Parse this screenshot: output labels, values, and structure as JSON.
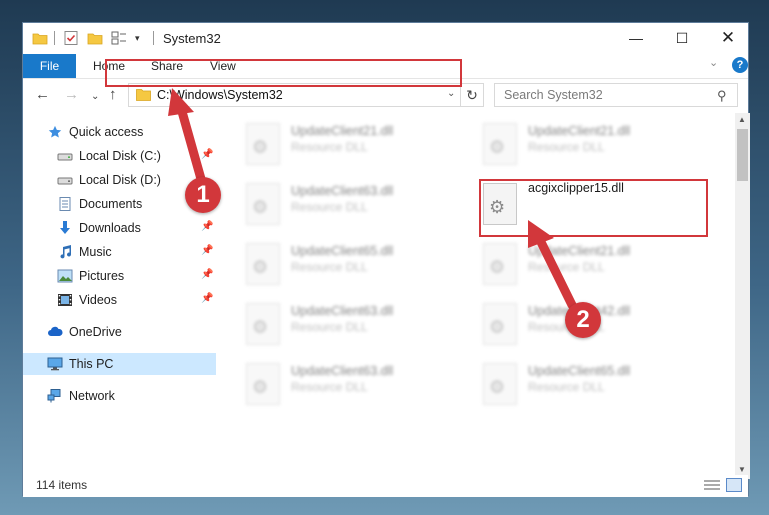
{
  "window": {
    "title": "System32",
    "controls": {
      "minimize": "—",
      "maximize": "☐",
      "close": "✕"
    }
  },
  "ribbon": {
    "tabs": [
      "File",
      "Home",
      "Share",
      "View"
    ],
    "help": "?"
  },
  "navigation": {
    "address": "C:\\Windows\\System32",
    "search_placeholder": "Search System32"
  },
  "sidebar": {
    "items": [
      {
        "label": "Quick access",
        "icon": "star-icon",
        "pinned": false
      },
      {
        "label": "Local Disk (C:)",
        "icon": "drive-icon",
        "pinned": true
      },
      {
        "label": "Local Disk (D:)",
        "icon": "drive-icon",
        "pinned": false
      },
      {
        "label": "Documents",
        "icon": "documents-icon",
        "pinned": false
      },
      {
        "label": "Downloads",
        "icon": "download-arrow-icon",
        "pinned": true
      },
      {
        "label": "Music",
        "icon": "music-note-icon",
        "pinned": true
      },
      {
        "label": "Pictures",
        "icon": "pictures-icon",
        "pinned": true
      },
      {
        "label": "Videos",
        "icon": "film-icon",
        "pinned": true
      },
      {
        "label": "OneDrive",
        "icon": "cloud-icon",
        "pinned": false
      },
      {
        "label": "This PC",
        "icon": "monitor-icon",
        "pinned": false,
        "selected": true
      },
      {
        "label": "Network",
        "icon": "network-icon",
        "pinned": false
      }
    ]
  },
  "files": [
    {
      "name": "UpdateClient21.dll",
      "desc": "Resource DLL",
      "blurred": true
    },
    {
      "name": "UpdateClient21.dll",
      "desc": "Resource DLL",
      "blurred": true
    },
    {
      "name": "UpdateClient63.dll",
      "desc": "Resource DLL",
      "blurred": true
    },
    {
      "name": "acgixclipper15.dll",
      "desc": "",
      "blurred": false
    },
    {
      "name": "UpdateClient65.dll",
      "desc": "Resource DLL",
      "blurred": true
    },
    {
      "name": "UpdateClient21.dll",
      "desc": "Resource DLL",
      "blurred": true
    },
    {
      "name": "UpdateClient63.dll",
      "desc": "Resource DLL",
      "blurred": true
    },
    {
      "name": "UpdateClient42.dll",
      "desc": "Resource DLL",
      "blurred": true
    },
    {
      "name": "UpdateClient63.dll",
      "desc": "Resource DLL",
      "blurred": true
    },
    {
      "name": "UpdateClient65.dll",
      "desc": "Resource DLL",
      "blurred": true
    }
  ],
  "status": {
    "item_count": "114 items"
  },
  "annotations": {
    "badge1": "1",
    "badge2": "2",
    "highlight_color": "#d2373b"
  }
}
